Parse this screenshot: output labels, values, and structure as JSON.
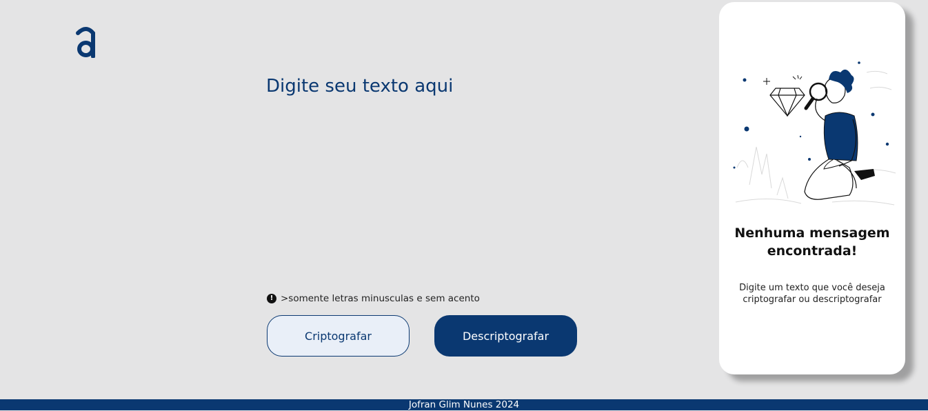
{
  "brand": {
    "logo_icon": "alura-a-logo-icon",
    "color_primary": "#0a3871",
    "color_background": "#e4e4e5",
    "color_card": "#ffffff"
  },
  "editor": {
    "placeholder": "Digite seu texto aqui",
    "value": ""
  },
  "hint": {
    "icon": "exclamation-circle-icon",
    "text": ">somente letras minusculas e sem acento"
  },
  "actions": {
    "encrypt_label": "Criptografar",
    "decrypt_label": "Descriptografar"
  },
  "result": {
    "illustration": "person-with-magnifying-glass-illustration",
    "title": "Nenhuma mensagem encontrada!",
    "description": "Digite um texto que você deseja criptografar ou descriptografar"
  },
  "footer": {
    "text": "Jofran Glim Nunes 2024"
  }
}
